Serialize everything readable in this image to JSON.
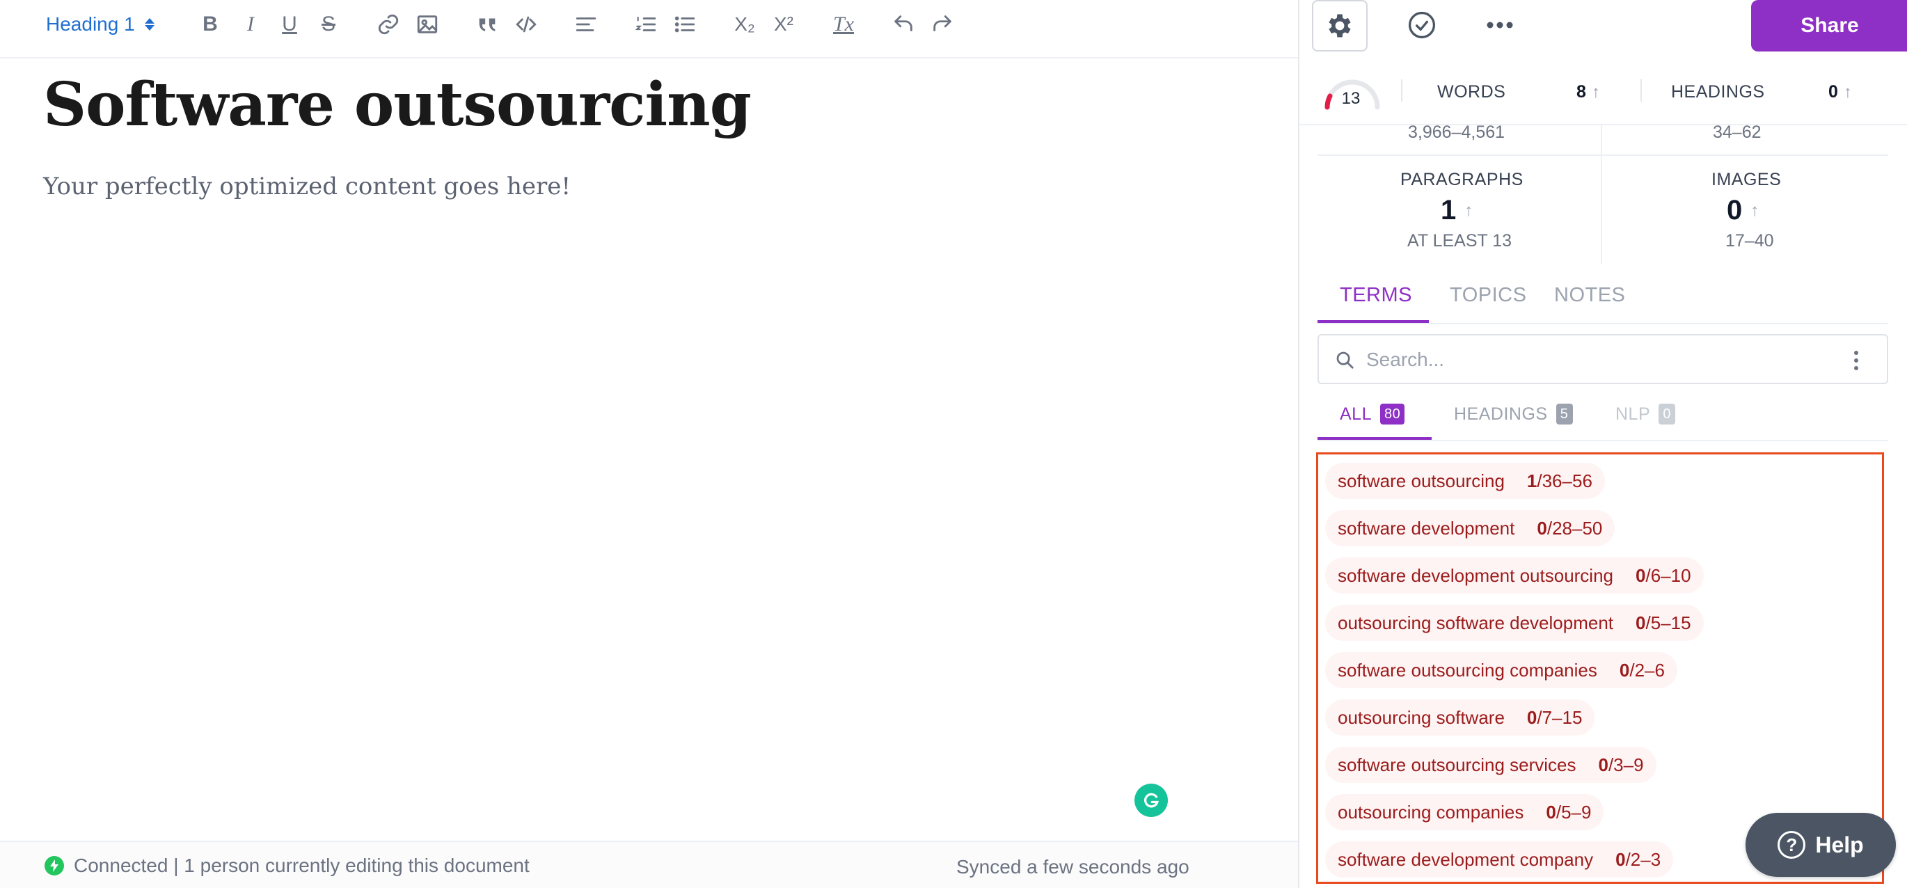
{
  "editor": {
    "heading_select": "Heading 1",
    "toolbar": {
      "bold": "B",
      "italic": "I",
      "underline": "U",
      "strike": "S",
      "subscript": "X₂",
      "superscript": "X²",
      "clear_format": "Tx"
    },
    "title": "Software outsourcing",
    "body": "Your perfectly optimized content goes here!",
    "status": {
      "connection": "Connected | 1 person currently editing this document",
      "synced": "Synced a few seconds ago"
    }
  },
  "sidebar": {
    "share_label": "Share",
    "score": "13",
    "words_label": "WORDS",
    "words_value": "8",
    "words_range": "3,966–4,561",
    "headings_label": "HEADINGS",
    "headings_value": "0",
    "headings_range": "34–62",
    "paragraphs_label": "PARAGRAPHS",
    "paragraphs_value": "1",
    "paragraphs_sub": "AT LEAST 13",
    "images_label": "IMAGES",
    "images_value": "0",
    "images_range": "17–40",
    "arrow": "↑",
    "tabs": [
      {
        "label": "TERMS"
      },
      {
        "label": "TOPICS"
      },
      {
        "label": "NOTES"
      }
    ],
    "search_placeholder": "Search...",
    "subtabs": [
      {
        "label": "ALL",
        "count": "80"
      },
      {
        "label": "HEADINGS",
        "count": "5"
      },
      {
        "label": "NLP",
        "count": "0"
      }
    ],
    "terms": [
      {
        "name": "software outsourcing",
        "used": "1",
        "range": "/36–56"
      },
      {
        "name": "software development",
        "used": "0",
        "range": "/28–50"
      },
      {
        "name": "software development outsourcing",
        "used": "0",
        "range": "/6–10"
      },
      {
        "name": "outsourcing software development",
        "used": "0",
        "range": "/5–15"
      },
      {
        "name": "software outsourcing companies",
        "used": "0",
        "range": "/2–6"
      },
      {
        "name": "outsourcing software",
        "used": "0",
        "range": "/7–15"
      },
      {
        "name": "software outsourcing services",
        "used": "0",
        "range": "/3–9"
      },
      {
        "name": "outsourcing companies",
        "used": "0",
        "range": "/5–9"
      },
      {
        "name": "software development company",
        "used": "0",
        "range": "/2–3"
      }
    ],
    "help_label": "Help"
  },
  "colors": {
    "accent": "#8e2fc5",
    "heading_select": "#1f6fd1",
    "term_text": "#9b1c1c",
    "highlight_border": "#e8491d",
    "connected": "#22c55e"
  }
}
